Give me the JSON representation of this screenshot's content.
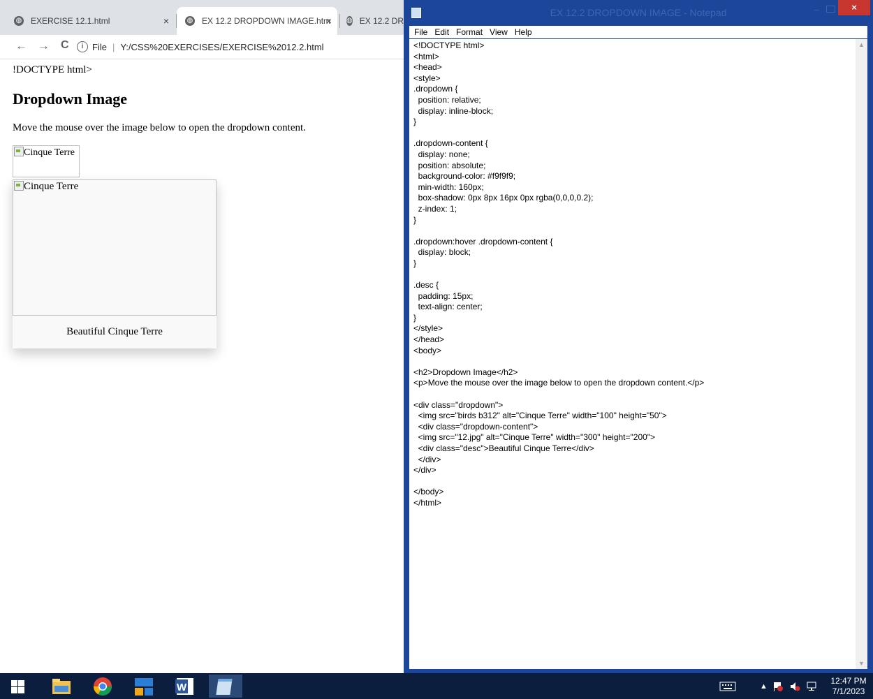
{
  "browser": {
    "tabs": [
      {
        "title": "EXERCISE 12.1.html",
        "close": "×"
      },
      {
        "title": "EX 12.2 DROPDOWN IMAGE.htm",
        "close": "×"
      },
      {
        "title": "EX 12.2 DRO"
      }
    ],
    "nav": {
      "back": "←",
      "forward": "→",
      "reload": "C"
    },
    "address": {
      "info": "i",
      "scheme": "File",
      "separator": "|",
      "url": "Y:/CSS%20EXERCISES/EXERCISE%2012.2.html"
    },
    "page": {
      "doctype_text": "!DOCTYPE html>",
      "heading": "Dropdown Image",
      "paragraph": "Move the mouse over the image below to open the dropdown content.",
      "small_image_alt": "Cinque Terre",
      "large_image_alt": "Cinque Terre",
      "desc": "Beautiful Cinque Terre"
    }
  },
  "notepad": {
    "title": "EX 12.2 DROPDOWN IMAGE - Notepad",
    "close": "×",
    "minimize": "–",
    "menu": [
      "File",
      "Edit",
      "Format",
      "View",
      "Help"
    ],
    "content": "<!DOCTYPE html>\n<html>\n<head>\n<style>\n.dropdown {\n  position: relative;\n  display: inline-block;\n}\n\n.dropdown-content {\n  display: none;\n  position: absolute;\n  background-color: #f9f9f9;\n  min-width: 160px;\n  box-shadow: 0px 8px 16px 0px rgba(0,0,0,0.2);\n  z-index: 1;\n}\n\n.dropdown:hover .dropdown-content {\n  display: block;\n}\n\n.desc {\n  padding: 15px;\n  text-align: center;\n}\n</style>\n</head>\n<body>\n\n<h2>Dropdown Image</h2>\n<p>Move the mouse over the image below to open the dropdown content.</p>\n\n<div class=\"dropdown\">\n  <img src=\"birds b312\" alt=\"Cinque Terre\" width=\"100\" height=\"50\">\n  <div class=\"dropdown-content\">\n  <img src=\"12.jpg\" alt=\"Cinque Terre\" width=\"300\" height=\"200\">\n  <div class=\"desc\">Beautiful Cinque Terre</div>\n  </div>\n</div>\n\n</body>\n</html>"
  },
  "taskbar": {
    "apps": [
      "windows-start-icon",
      "file-explorer-icon",
      "chrome-icon",
      "app-blue-icon",
      "word-icon",
      "notepad-icon"
    ],
    "word_letter": "W",
    "tray_chevron": "▲",
    "time": "12:47 PM",
    "date": "7/1/2023"
  },
  "colors": {
    "notepad_frame": "#1b4699",
    "taskbar": "#0b1e3d",
    "close_button": "#c7372f",
    "tab_bar": "#dee1e6"
  }
}
